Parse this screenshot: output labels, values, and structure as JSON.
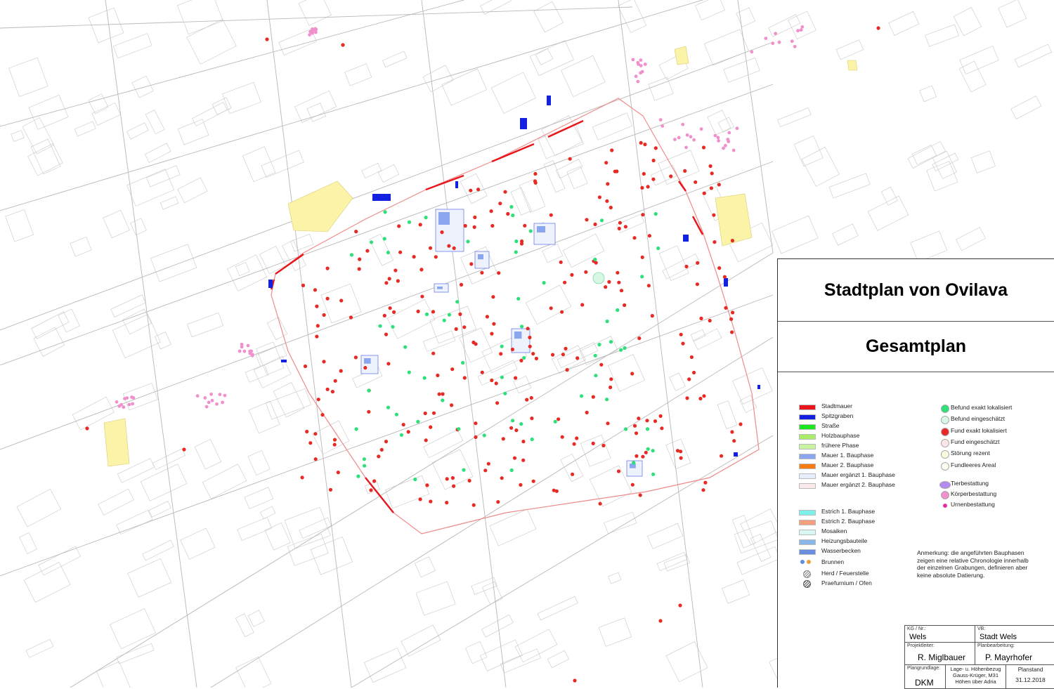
{
  "title": "Stadtplan von Ovilava",
  "subtitle": "Gesamtplan",
  "legend_left": [
    {
      "label": "Stadtmauer",
      "color": "#e8161b",
      "icon": "swatch"
    },
    {
      "label": "Spitzgraben",
      "color": "#1420e0",
      "icon": "swatch"
    },
    {
      "label": "Straße",
      "color": "#1ee61e",
      "icon": "swatch"
    },
    {
      "label": "Holzbauphase",
      "color": "#a8ec6a",
      "icon": "swatch"
    },
    {
      "label": "frühere Phase",
      "color": "#c8f4a0",
      "icon": "swatch"
    },
    {
      "label": "Mauer 1. Bauphase",
      "color": "#8aa6ee",
      "icon": "swatch"
    },
    {
      "label": "Mauer 2. Bauphase",
      "color": "#f47c10",
      "icon": "swatch"
    },
    {
      "label": "Mauer ergänzt 1. Bauphase",
      "color": "#e6eefc",
      "icon": "swatch"
    },
    {
      "label": "Mauer ergänzt 2. Bauphase",
      "color": "#fbeaea",
      "icon": "swatch"
    },
    {
      "label": "Estrich 1. Bauphase",
      "color": "#7ef0ea",
      "icon": "swatch"
    },
    {
      "label": "Estrich 2. Bauphase",
      "color": "#f4a07c",
      "icon": "swatch"
    },
    {
      "label": "Mosaiken",
      "color": "#d8f6f4",
      "icon": "swatch"
    },
    {
      "label": "Heizungsbauteile",
      "color": "#8ab6e8",
      "icon": "swatch"
    },
    {
      "label": "Wasserbecken",
      "color": "#6a8ee0",
      "icon": "swatch"
    },
    {
      "label": "Brunnen",
      "color": "#5a8ee0",
      "icon": "well"
    },
    {
      "label": "Herd / Feuerstelle",
      "color": "#888888",
      "icon": "hatch"
    },
    {
      "label": "Praefurnium / Ofen",
      "color": "#555555",
      "icon": "hatch"
    }
  ],
  "legend_right": [
    {
      "label": "Befund exakt lokalisiert",
      "color": "#2ee07a",
      "icon": "dot"
    },
    {
      "label": "Befund eingeschätzt",
      "color": "#d8f8e6",
      "icon": "dot"
    },
    {
      "label": "Fund exakt lokalisiert",
      "color": "#e82a24",
      "icon": "dot"
    },
    {
      "label": "Fund eingeschätzt",
      "color": "#fce6e6",
      "icon": "dot"
    },
    {
      "label": "Störung rezent",
      "color": "#fefce0",
      "icon": "dot"
    },
    {
      "label": "Fundleeres Areal",
      "color": "#fefef2",
      "icon": "dot"
    },
    {
      "label": "Tierbestattung",
      "color": "#b48aee",
      "icon": "oval"
    },
    {
      "label": "Körperbestattung",
      "color": "#f090cc",
      "icon": "dot"
    },
    {
      "label": "Urnenbestattung",
      "color": "#e0329a",
      "icon": "small"
    }
  ],
  "note": "Anmerkung: die angeführten Bauphasen zeigen eine relative Chronologie innerhalb der einzelnen Grabungen, definieren aber keine absolute Datierung.",
  "titleblock": {
    "kg_label": "KG / Nr.:",
    "kg_value": "Wels",
    "vb_label": "VB:",
    "vb_value": "Stadt Wels",
    "projektleiter_label": "Projektleiter:",
    "projektleiter_value": "R. Miglbauer",
    "planbearbeitung_label": "Planbearbeitung:",
    "planbearbeitung_value": "P. Mayrhofer",
    "plangrundlage_label": "Plangrundlage:",
    "plangrundlage_value": "DKM",
    "bezug_line1": "Lage- u. Höhenbezug",
    "bezug_line2": "Gauss-Krüger, M31",
    "bezug_line3": "Höhen über Adria",
    "planstand_label": "Planstand",
    "planstand_value": "31.12.2018"
  },
  "colors": {
    "cadastre_line": "#c8c8c8",
    "wall": "#e8161b",
    "ditch": "#1420e0",
    "find": "#e82a24",
    "feature": "#2ee07a",
    "burial": "#f090cc",
    "yellow_area": "#fbf3a8"
  }
}
